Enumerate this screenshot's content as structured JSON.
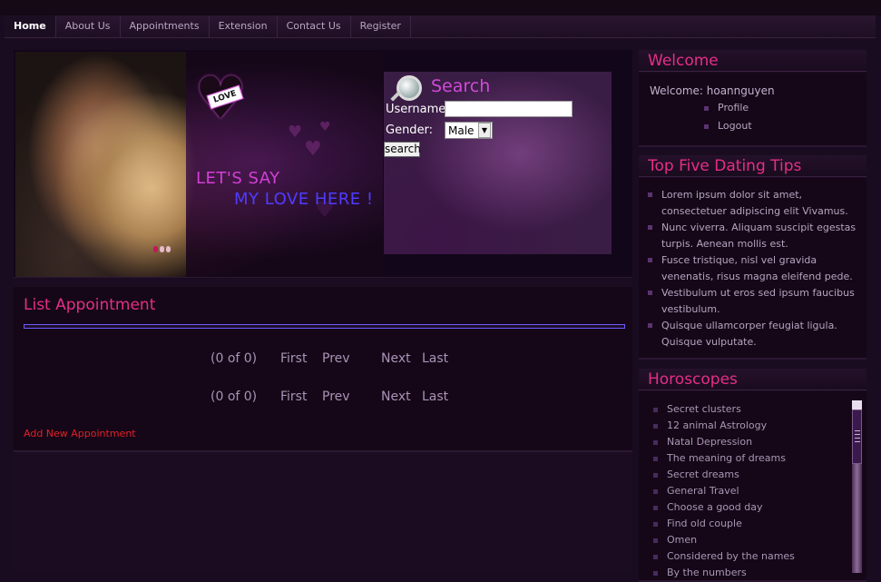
{
  "nav": {
    "items": [
      "Home",
      "About Us",
      "Appointments",
      "Extension",
      "Contact Us",
      "Register"
    ],
    "active": "Home"
  },
  "banner": {
    "love_tag": "LOVE",
    "slogan_line1": "LET'S SAY",
    "slogan_line2": "MY LOVE HERE !"
  },
  "search": {
    "title": "Search",
    "username_label": "Username:",
    "username_value": "",
    "gender_label": "Gender:",
    "gender_value": "Male",
    "button": "search"
  },
  "appointments": {
    "title": "List Appointment",
    "pager": {
      "count": "(0 of 0)",
      "first": "First",
      "prev": "Prev",
      "next": "Next",
      "last": "Last"
    },
    "add_link": "Add New Appointment"
  },
  "welcome": {
    "title": "Welcome",
    "text": "Welcome: hoannguyen",
    "links": [
      "Profile",
      "Logout"
    ]
  },
  "tips": {
    "title": "Top Five Dating Tips",
    "items": [
      "Lorem ipsum dolor sit amet, consectetuer adipiscing elit Vivamus.",
      "Nunc viverra. Aliquam suscipit egestas turpis. Aenean mollis est.",
      "Fusce tristique, nisl vel gravida venenatis, risus magna eleifend pede.",
      "Vestibulum ut eros sed ipsum faucibus vestibulum.",
      "Quisque ullamcorper feugiat ligula. Quisque vulputate."
    ]
  },
  "horoscopes": {
    "title": "Horoscopes",
    "items": [
      "Secret clusters",
      "12 animal Astrology",
      "Natal Depression",
      "The meaning of dreams",
      "Secret dreams",
      "General Travel",
      "Choose a good day",
      "Find old couple",
      "Omen",
      "Considered by the names",
      "By the numbers"
    ]
  }
}
